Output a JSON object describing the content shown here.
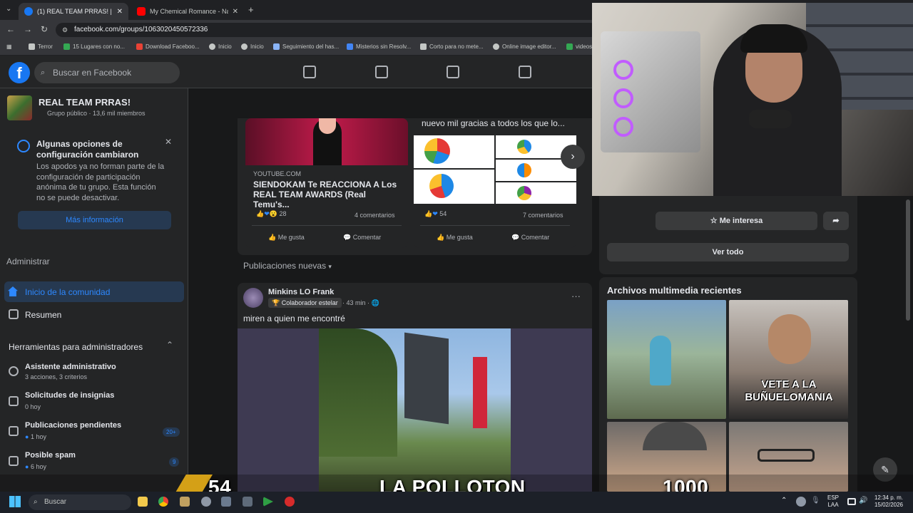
{
  "browser": {
    "tabs": [
      {
        "label": "(1) REAL TEAM PRRAS! | Facebo",
        "active": true
      },
      {
        "label": "My Chemical Romance - Na Na",
        "active": false
      }
    ],
    "url": "facebook.com/groups/1063020450572336",
    "bookmarks": [
      "Terror",
      "15 Lugares con no...",
      "Download Faceboo...",
      "Inicio",
      "Inicio",
      "Seguimiento del has...",
      "Misterios sin Resolv...",
      "Corto para no mete...",
      "Online image editor...",
      "videos"
    ]
  },
  "fb": {
    "search_placeholder": "Buscar en Facebook",
    "group_name": "REAL TEAM PRRAS!",
    "group_meta": "Grupo público · 13,6 mil miembros",
    "notice": {
      "title": "Algunas opciones de configuración cambiaron",
      "body": "Los apodos ya no forman parte de la configuración de participación anónima de tu grupo. Esta función no se puede desactivar.",
      "button": "Más información"
    },
    "admin_heading": "Administrar",
    "nav": {
      "home": "Inicio de la comunidad",
      "summary": "Resumen"
    },
    "tools_heading": "Herramientas para administradores",
    "tools": [
      {
        "title": "Asistente administrativo",
        "sub": "3 acciones, 3 criterios",
        "badge": ""
      },
      {
        "title": "Solicitudes de insignias",
        "sub": "0 hoy",
        "badge": ""
      },
      {
        "title": "Publicaciones pendientes",
        "sub": "1 hoy",
        "badge": "20+"
      },
      {
        "title": "Posible spam",
        "sub": "6 hoy",
        "badge": "9"
      }
    ]
  },
  "shares": [
    {
      "source": "YOUTUBE.COM",
      "title": "SIENDOKAM Te REACCIONA A Los REAL TEAM AWARDS (Real Temu's...",
      "count": "28",
      "comments": "4 comentarios",
      "like": "Me gusta",
      "comment": "Comentar"
    },
    {
      "caption": "nuevo mil gracias a todos los que lo...",
      "count": "54",
      "comments": "7 comentarios",
      "like": "Me gusta",
      "comment": "Comentar"
    }
  ],
  "new_posts_label": "Publicaciones nuevas",
  "post": {
    "author": "Minkins LO Frank",
    "badge": "Colaborador estelar",
    "time": "· 43 min ·",
    "text": "miren a quien me encontré",
    "more": "···"
  },
  "right": {
    "interest_button": "Me interesa",
    "see_all": "Ver todo",
    "media_heading": "Archivos multimedia recientes",
    "thumb_caption": "VETE A LA BUÑUELOMANIA"
  },
  "overlay": {
    "left_number": "54",
    "title": "LA POLLOTON",
    "right_number": "1000"
  },
  "taskbar": {
    "search": "Buscar",
    "lang": "ESP",
    "lang2": "LAA",
    "time": "12:34 p. m.",
    "date": "15/02/2026"
  }
}
